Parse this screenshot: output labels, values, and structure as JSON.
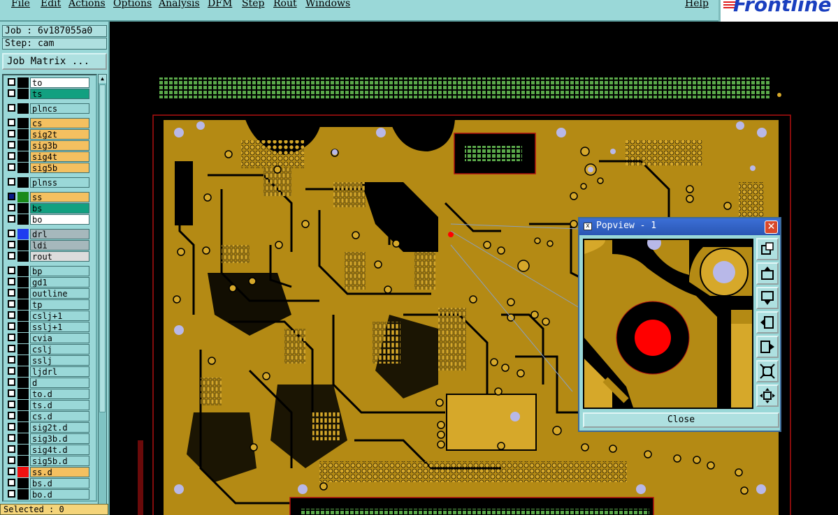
{
  "menubar": {
    "items": [
      "File",
      "Edit",
      "Actions",
      "Options",
      "Analysis",
      "DFM",
      "Step",
      "Rout",
      "Windows"
    ],
    "help": "Help",
    "logo": "Frontline"
  },
  "panel": {
    "job_label": "Job : 6v187055a0",
    "step_label": "Step: cam",
    "job_matrix": "Job Matrix ...",
    "status": "Selected : 0"
  },
  "layers": [
    {
      "name": "to",
      "color": "#ffffff",
      "swatch": "#000000",
      "on": false
    },
    {
      "name": "ts",
      "color": "#12a080",
      "swatch": "#000000",
      "on": false
    },
    {
      "name": "plncs",
      "color": "#9ad8d8",
      "swatch": "#000000",
      "on": false
    },
    {
      "name": "cs",
      "color": "#f4c060",
      "swatch": "#000000",
      "on": false
    },
    {
      "name": "sig2t",
      "color": "#f4c060",
      "swatch": "#000000",
      "on": false
    },
    {
      "name": "sig3b",
      "color": "#f4c060",
      "swatch": "#000000",
      "on": false
    },
    {
      "name": "sig4t",
      "color": "#f4c060",
      "swatch": "#000000",
      "on": false
    },
    {
      "name": "sig5b",
      "color": "#f4c060",
      "swatch": "#000000",
      "on": false
    },
    {
      "name": "plnss",
      "color": "#9ad8d8",
      "swatch": "#000000",
      "on": false
    },
    {
      "name": "ss",
      "color": "#f4c060",
      "swatch": "#1a8a1a",
      "on": true
    },
    {
      "name": "bs",
      "color": "#12a080",
      "swatch": "#000000",
      "on": false
    },
    {
      "name": "bo",
      "color": "#ffffff",
      "swatch": "#000000",
      "on": false
    },
    {
      "name": "drl",
      "color": "#a6b8bc",
      "swatch": "#1e3cf0",
      "on": false
    },
    {
      "name": "ldi",
      "color": "#a6b8bc",
      "swatch": "#000000",
      "on": false
    },
    {
      "name": "rout",
      "color": "#dcdcdc",
      "swatch": "#000000",
      "on": false
    },
    {
      "name": "bp",
      "color": "#9ad8d8",
      "swatch": "#000000",
      "on": false
    },
    {
      "name": "gd1",
      "color": "#9ad8d8",
      "swatch": "#000000",
      "on": false
    },
    {
      "name": "outline",
      "color": "#9ad8d8",
      "swatch": "#000000",
      "on": false
    },
    {
      "name": "tp",
      "color": "#9ad8d8",
      "swatch": "#000000",
      "on": false
    },
    {
      "name": "cslj+1",
      "color": "#9ad8d8",
      "swatch": "#000000",
      "on": false
    },
    {
      "name": "sslj+1",
      "color": "#9ad8d8",
      "swatch": "#000000",
      "on": false
    },
    {
      "name": "cvia",
      "color": "#9ad8d8",
      "swatch": "#000000",
      "on": false
    },
    {
      "name": "cslj",
      "color": "#9ad8d8",
      "swatch": "#000000",
      "on": false
    },
    {
      "name": "sslj",
      "color": "#9ad8d8",
      "swatch": "#000000",
      "on": false
    },
    {
      "name": "ljdrl",
      "color": "#9ad8d8",
      "swatch": "#000000",
      "on": false
    },
    {
      "name": "d",
      "color": "#9ad8d8",
      "swatch": "#000000",
      "on": false
    },
    {
      "name": "to.d",
      "color": "#9ad8d8",
      "swatch": "#000000",
      "on": false
    },
    {
      "name": "ts.d",
      "color": "#9ad8d8",
      "swatch": "#000000",
      "on": false
    },
    {
      "name": "cs.d",
      "color": "#9ad8d8",
      "swatch": "#000000",
      "on": false
    },
    {
      "name": "sig2t.d",
      "color": "#9ad8d8",
      "swatch": "#000000",
      "on": false
    },
    {
      "name": "sig3b.d",
      "color": "#9ad8d8",
      "swatch": "#000000",
      "on": false
    },
    {
      "name": "sig4t.d",
      "color": "#9ad8d8",
      "swatch": "#000000",
      "on": false
    },
    {
      "name": "sig5b.d",
      "color": "#9ad8d8",
      "swatch": "#000000",
      "on": false
    },
    {
      "name": "ss.d",
      "color": "#f4c060",
      "swatch": "#f01010",
      "on": false
    },
    {
      "name": "bs.d",
      "color": "#9ad8d8",
      "swatch": "#000000",
      "on": false
    },
    {
      "name": "bo.d",
      "color": "#9ad8d8",
      "swatch": "#000000",
      "on": false
    }
  ],
  "popview": {
    "title": "Popview - 1",
    "close_label": "Close",
    "tools": [
      "zoom-fit-icon",
      "pan-up-icon",
      "pan-down-icon",
      "pan-left-icon",
      "pan-right-icon",
      "zoom-out-icon",
      "zoom-in-icon"
    ]
  },
  "colors": {
    "board": "#b48a14",
    "copper": "#d6a82a",
    "pad_green": "#5aa84a",
    "drill": "#b8b8e8",
    "highlight": "#ff0000",
    "panel_bg": "#9ad8d8"
  }
}
